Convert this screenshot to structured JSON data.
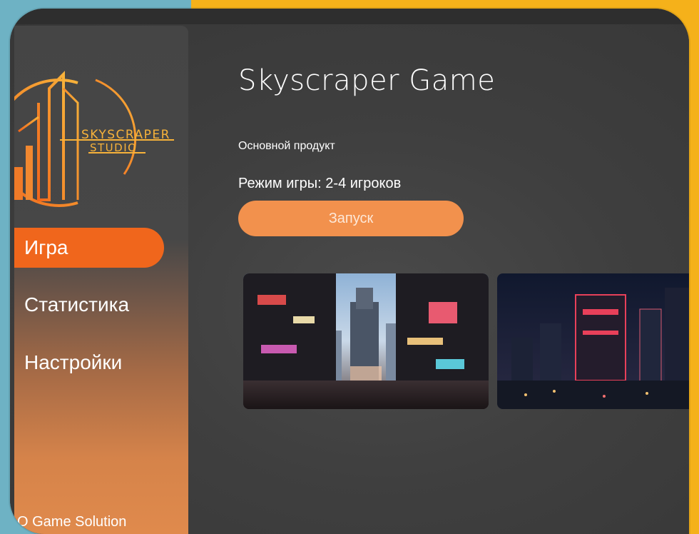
{
  "colors": {
    "accent": "#f0661c",
    "button": "#f2914d",
    "window_bg": "#353535",
    "frame_teal": "#6eb2c4",
    "frame_yellow": "#f5b11a"
  },
  "logo": {
    "line1": "SKYSCRAPER",
    "line2": "STUDIO"
  },
  "sidebar": {
    "items": [
      {
        "label": "Игра",
        "active": true
      },
      {
        "label": "Статистика",
        "active": false
      },
      {
        "label": "Настройки",
        "active": false
      }
    ],
    "footer": "O Game Solution"
  },
  "main": {
    "title": "Skyscraper Game",
    "subtitle": "Основной продукт",
    "mode": "Режим игры: 2-4 игроков",
    "launch_label": "Запуск"
  },
  "gallery": {
    "images": [
      {
        "icon": "cyberpunk-city-street-image"
      },
      {
        "icon": "night-city-skyline-image"
      }
    ]
  }
}
